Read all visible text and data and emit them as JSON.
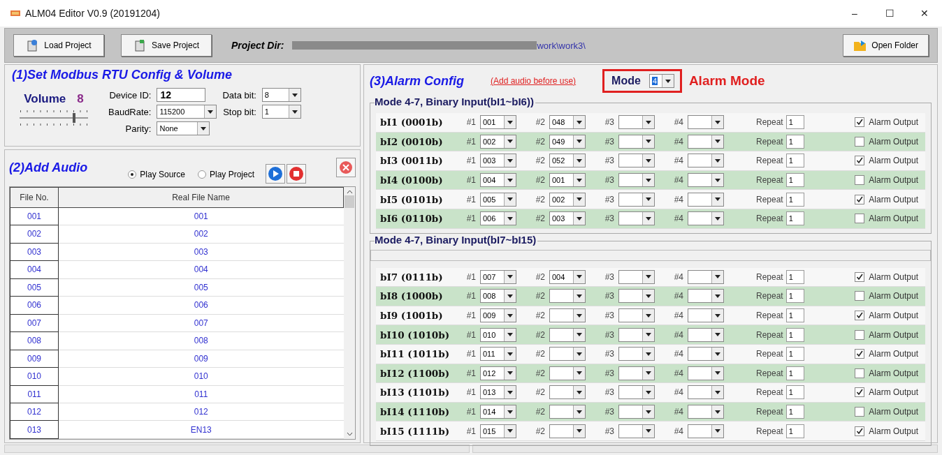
{
  "window": {
    "title": "ALM04 Editor V0.9 (20191204)",
    "controls": [
      "–",
      "☐",
      "✕"
    ]
  },
  "toolbar": {
    "load_button": "Load Project",
    "save_button": "Save Project",
    "project_dir_label": "Project Dir:",
    "project_dir_value": "work\\work3\\",
    "open_folder_button": "Open Folder"
  },
  "modbus": {
    "title": "(1)Set Modbus RTU Config & Volume",
    "volume_label": "Volume",
    "volume_value": "8",
    "volume": {
      "level": 0.8
    },
    "fields": [
      {
        "label": "Device ID:",
        "value": "12",
        "kind": "text"
      },
      {
        "label": "Data bit:",
        "value": "8",
        "kind": "select"
      },
      {
        "label": "BaudRate:",
        "value": "115200",
        "kind": "select"
      },
      {
        "label": "Stop bit:",
        "value": "1",
        "kind": "select"
      },
      {
        "label": "Parity:",
        "value": "None",
        "kind": "select"
      }
    ]
  },
  "audio": {
    "title": "(2)Add Audio",
    "sources": [
      {
        "label": "Play Source",
        "selected": true
      },
      {
        "label": "Play Project",
        "selected": false
      }
    ],
    "table": {
      "columns": [
        "File No.",
        "Real File Name"
      ],
      "rows": [
        [
          "001",
          "001"
        ],
        [
          "002",
          "002"
        ],
        [
          "003",
          "003"
        ],
        [
          "004",
          "004"
        ],
        [
          "005",
          "005"
        ],
        [
          "006",
          "006"
        ],
        [
          "007",
          "007"
        ],
        [
          "008",
          "008"
        ],
        [
          "009",
          "009"
        ],
        [
          "010",
          "010"
        ],
        [
          "011",
          "011"
        ],
        [
          "012",
          "012"
        ],
        [
          "013",
          "EN13"
        ]
      ]
    }
  },
  "alarm": {
    "title": "(3)Alarm Config",
    "hint": "(Add audio before use)",
    "mode_label": "Mode",
    "mode_value": "4",
    "annotation": "Alarm Mode",
    "groups": [
      {
        "title": "Mode 4-7, Binary Input(bI1~bI6))",
        "rows": [
          {
            "label": "bI1 (0001b)",
            "slots": [
              {
                "label": "#1",
                "value": "001"
              },
              {
                "label": "#2",
                "value": "048"
              },
              {
                "label": "#3"
              },
              {
                "label": "#4"
              }
            ],
            "repeat_label": "Repeat",
            "repeat": "1",
            "output_label": "Alarm Output",
            "alarm_output": true
          },
          {
            "label": "bI2 (0010b)",
            "slots": [
              {
                "label": "#1",
                "value": "002"
              },
              {
                "label": "#2",
                "value": "049"
              },
              {
                "label": "#3"
              },
              {
                "label": "#4"
              }
            ],
            "repeat_label": "Repeat",
            "repeat": "1",
            "output_label": "Alarm Output",
            "alarm_output": false
          },
          {
            "label": "bI3 (0011b)",
            "slots": [
              {
                "label": "#1",
                "value": "003"
              },
              {
                "label": "#2",
                "value": "052"
              },
              {
                "label": "#3"
              },
              {
                "label": "#4"
              }
            ],
            "repeat_label": "Repeat",
            "repeat": "1",
            "output_label": "Alarm Output",
            "alarm_output": true
          },
          {
            "label": "bI4 (0100b)",
            "slots": [
              {
                "label": "#1",
                "value": "004"
              },
              {
                "label": "#2",
                "value": "001"
              },
              {
                "label": "#3"
              },
              {
                "label": "#4"
              }
            ],
            "repeat_label": "Repeat",
            "repeat": "1",
            "output_label": "Alarm Output",
            "alarm_output": false
          },
          {
            "label": "bI5 (0101b)",
            "slots": [
              {
                "label": "#1",
                "value": "005"
              },
              {
                "label": "#2",
                "value": "002"
              },
              {
                "label": "#3"
              },
              {
                "label": "#4"
              }
            ],
            "repeat_label": "Repeat",
            "repeat": "1",
            "output_label": "Alarm Output",
            "alarm_output": true
          },
          {
            "label": "bI6 (0110b)",
            "slots": [
              {
                "label": "#1",
                "value": "006"
              },
              {
                "label": "#2",
                "value": "003"
              },
              {
                "label": "#3"
              },
              {
                "label": "#4"
              }
            ],
            "repeat_label": "Repeat",
            "repeat": "1",
            "output_label": "Alarm Output",
            "alarm_output": false
          }
        ]
      },
      {
        "title": "Mode 4-7, Binary Input(bI7~bI15)",
        "rows": [
          {
            "label": "bI7 (0111b)",
            "slots": [
              {
                "label": "#1",
                "value": "007"
              },
              {
                "label": "#2",
                "value": "004"
              },
              {
                "label": "#3"
              },
              {
                "label": "#4"
              }
            ],
            "repeat_label": "Repeat",
            "repeat": "1",
            "output_label": "Alarm Output",
            "alarm_output": true
          },
          {
            "label": "bI8 (1000b)",
            "slots": [
              {
                "label": "#1",
                "value": "008"
              },
              {
                "label": "#2"
              },
              {
                "label": "#3"
              },
              {
                "label": "#4"
              }
            ],
            "repeat_label": "Repeat",
            "repeat": "1",
            "output_label": "Alarm Output",
            "alarm_output": false
          },
          {
            "label": "bI9 (1001b)",
            "slots": [
              {
                "label": "#1",
                "value": "009"
              },
              {
                "label": "#2"
              },
              {
                "label": "#3"
              },
              {
                "label": "#4"
              }
            ],
            "repeat_label": "Repeat",
            "repeat": "1",
            "output_label": "Alarm Output",
            "alarm_output": true
          },
          {
            "label": "bI10 (1010b)",
            "slots": [
              {
                "label": "#1",
                "value": "010"
              },
              {
                "label": "#2"
              },
              {
                "label": "#3"
              },
              {
                "label": "#4"
              }
            ],
            "repeat_label": "Repeat",
            "repeat": "1",
            "output_label": "Alarm Output",
            "alarm_output": false
          },
          {
            "label": "bI11 (1011b)",
            "slots": [
              {
                "label": "#1",
                "value": "011"
              },
              {
                "label": "#2"
              },
              {
                "label": "#3"
              },
              {
                "label": "#4"
              }
            ],
            "repeat_label": "Repeat",
            "repeat": "1",
            "output_label": "Alarm Output",
            "alarm_output": true
          },
          {
            "label": "bI12 (1100b)",
            "slots": [
              {
                "label": "#1",
                "value": "012"
              },
              {
                "label": "#2"
              },
              {
                "label": "#3"
              },
              {
                "label": "#4"
              }
            ],
            "repeat_label": "Repeat",
            "repeat": "1",
            "output_label": "Alarm Output",
            "alarm_output": false
          },
          {
            "label": "bI13 (1101b)",
            "slots": [
              {
                "label": "#1",
                "value": "013"
              },
              {
                "label": "#2"
              },
              {
                "label": "#3"
              },
              {
                "label": "#4"
              }
            ],
            "repeat_label": "Repeat",
            "repeat": "1",
            "output_label": "Alarm Output",
            "alarm_output": true
          },
          {
            "label": "bI14 (1110b)",
            "slots": [
              {
                "label": "#1",
                "value": "014"
              },
              {
                "label": "#2"
              },
              {
                "label": "#3"
              },
              {
                "label": "#4"
              }
            ],
            "repeat_label": "Repeat",
            "repeat": "1",
            "output_label": "Alarm Output",
            "alarm_output": false
          },
          {
            "label": "bI15 (1111b)",
            "slots": [
              {
                "label": "#1",
                "value": "015"
              },
              {
                "label": "#2"
              },
              {
                "label": "#3"
              },
              {
                "label": "#4"
              }
            ],
            "repeat_label": "Repeat",
            "repeat": "1",
            "output_label": "Alarm Output",
            "alarm_output": true
          }
        ]
      }
    ]
  }
}
